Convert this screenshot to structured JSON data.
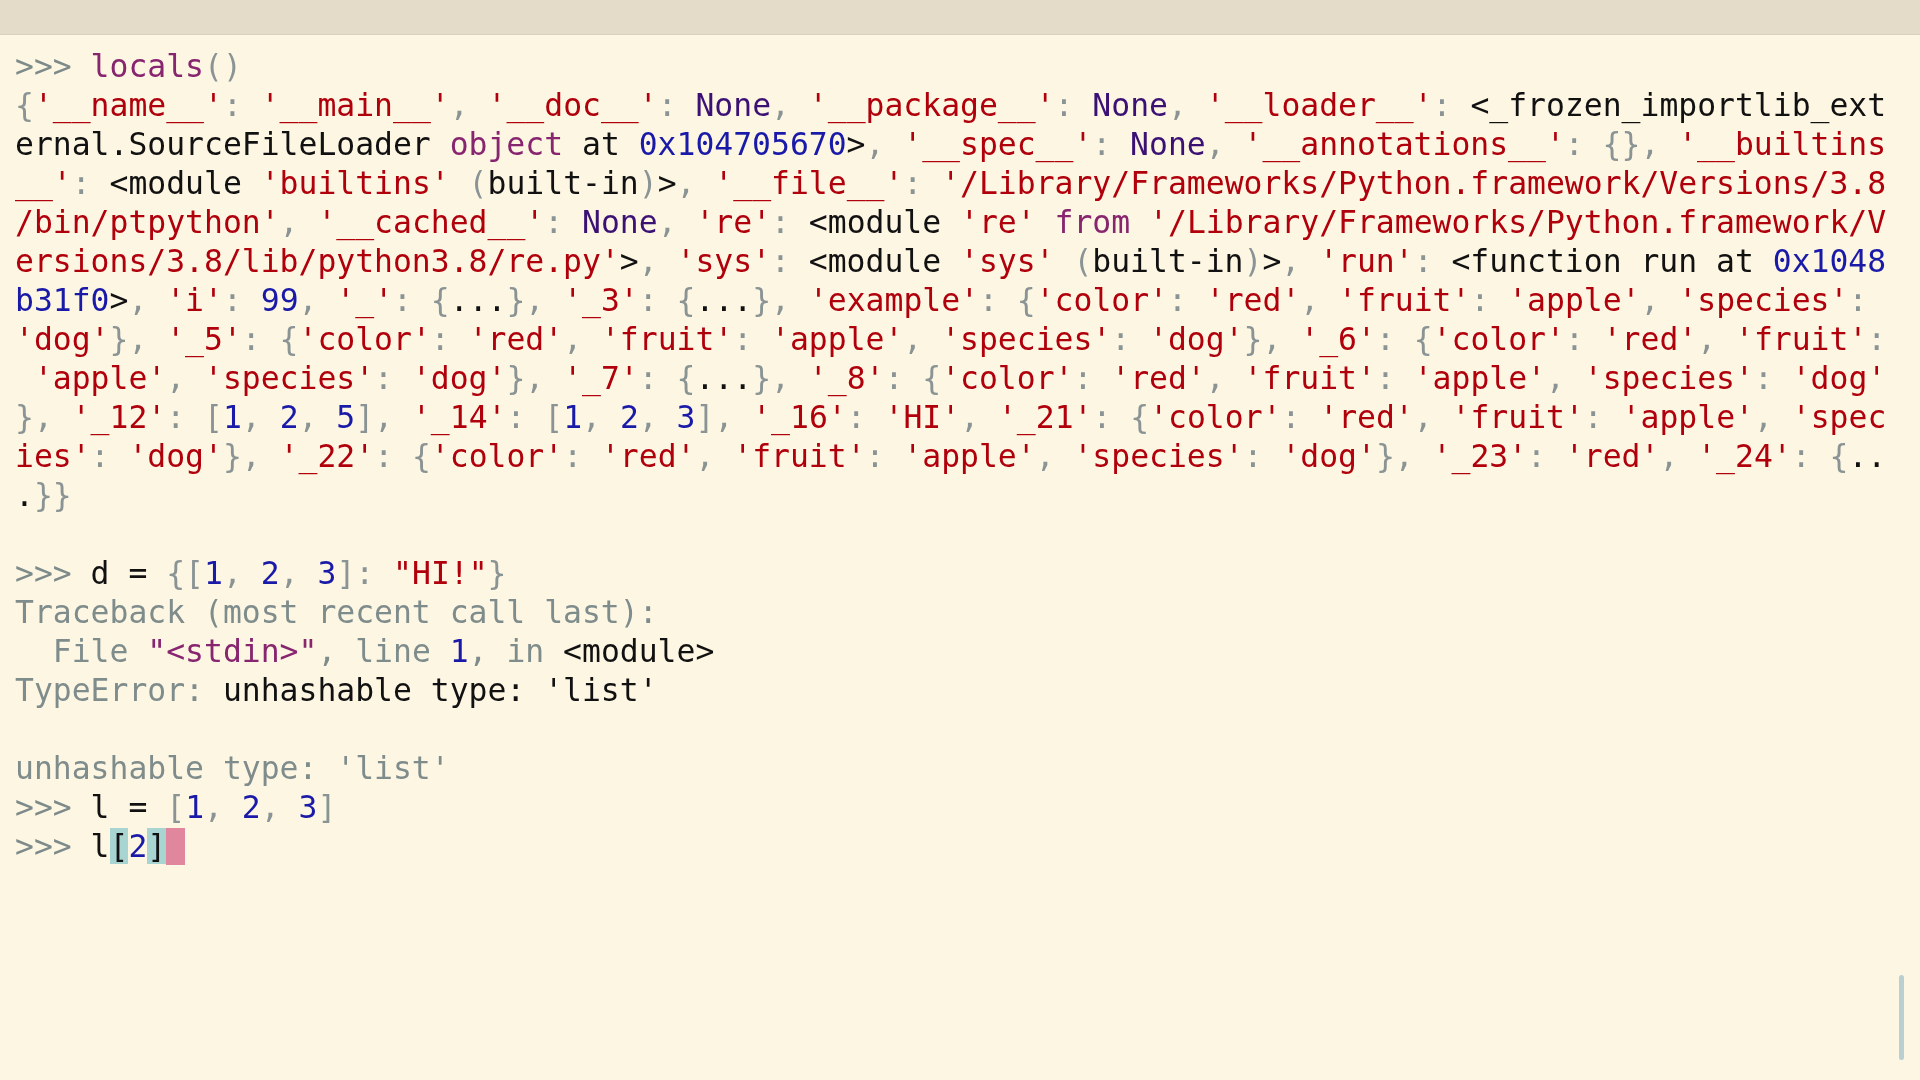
{
  "lines": [
    {
      "segments": [
        {
          "kind": "prompt",
          "text": ">>> "
        },
        {
          "kind": "keyword",
          "text": "locals"
        },
        {
          "kind": "punct",
          "text": "()"
        }
      ]
    },
    {
      "segments": [
        {
          "kind": "punct",
          "text": "{"
        },
        {
          "kind": "string",
          "text": "'__name__'"
        },
        {
          "kind": "punct",
          "text": ": "
        },
        {
          "kind": "string",
          "text": "'__main__'"
        },
        {
          "kind": "punct",
          "text": ", "
        },
        {
          "kind": "string",
          "text": "'__doc__'"
        },
        {
          "kind": "punct",
          "text": ": "
        },
        {
          "kind": "builtin",
          "text": "None"
        },
        {
          "kind": "punct",
          "text": ", "
        },
        {
          "kind": "string",
          "text": "'__package__'"
        },
        {
          "kind": "punct",
          "text": ": "
        },
        {
          "kind": "builtin",
          "text": "None"
        },
        {
          "kind": "punct",
          "text": ", "
        },
        {
          "kind": "string",
          "text": "'__loader__'"
        },
        {
          "kind": "punct",
          "text": ": "
        },
        {
          "kind": "plain",
          "text": "<_frozen_importlib_ext"
        }
      ]
    },
    {
      "segments": [
        {
          "kind": "plain",
          "text": "ernal.SourceFileLoader "
        },
        {
          "kind": "keyword",
          "text": "object"
        },
        {
          "kind": "plain",
          "text": " at "
        },
        {
          "kind": "number",
          "text": "0x104705670"
        },
        {
          "kind": "plain",
          "text": ">"
        },
        {
          "kind": "punct",
          "text": ", "
        },
        {
          "kind": "string",
          "text": "'__spec__'"
        },
        {
          "kind": "punct",
          "text": ": "
        },
        {
          "kind": "builtin",
          "text": "None"
        },
        {
          "kind": "punct",
          "text": ", "
        },
        {
          "kind": "string",
          "text": "'__annotations__'"
        },
        {
          "kind": "punct",
          "text": ": {}, "
        },
        {
          "kind": "string",
          "text": "'__builtins"
        }
      ]
    },
    {
      "segments": [
        {
          "kind": "string",
          "text": "__'"
        },
        {
          "kind": "punct",
          "text": ": "
        },
        {
          "kind": "plain",
          "text": "<module "
        },
        {
          "kind": "string",
          "text": "'builtins'"
        },
        {
          "kind": "punct",
          "text": " ("
        },
        {
          "kind": "plain",
          "text": "built-in"
        },
        {
          "kind": "punct",
          "text": ")"
        },
        {
          "kind": "plain",
          "text": ">"
        },
        {
          "kind": "punct",
          "text": ", "
        },
        {
          "kind": "string",
          "text": "'__file__'"
        },
        {
          "kind": "punct",
          "text": ": "
        },
        {
          "kind": "string",
          "text": "'/Library/Frameworks/Python.framework/Versions/3.8"
        }
      ]
    },
    {
      "segments": [
        {
          "kind": "string",
          "text": "/bin/ptpython'"
        },
        {
          "kind": "punct",
          "text": ", "
        },
        {
          "kind": "string",
          "text": "'__cached__'"
        },
        {
          "kind": "punct",
          "text": ": "
        },
        {
          "kind": "builtin",
          "text": "None"
        },
        {
          "kind": "punct",
          "text": ", "
        },
        {
          "kind": "string",
          "text": "'re'"
        },
        {
          "kind": "punct",
          "text": ": "
        },
        {
          "kind": "plain",
          "text": "<module "
        },
        {
          "kind": "string",
          "text": "'re'"
        },
        {
          "kind": "keyword",
          "text": " from "
        },
        {
          "kind": "string",
          "text": "'/Library/Frameworks/Python.framework/V"
        }
      ]
    },
    {
      "segments": [
        {
          "kind": "string",
          "text": "ersions/3.8/lib/python3.8/re.py'"
        },
        {
          "kind": "plain",
          "text": ">"
        },
        {
          "kind": "punct",
          "text": ", "
        },
        {
          "kind": "string",
          "text": "'sys'"
        },
        {
          "kind": "punct",
          "text": ": "
        },
        {
          "kind": "plain",
          "text": "<module "
        },
        {
          "kind": "string",
          "text": "'sys'"
        },
        {
          "kind": "punct",
          "text": " ("
        },
        {
          "kind": "plain",
          "text": "built-in"
        },
        {
          "kind": "punct",
          "text": ")"
        },
        {
          "kind": "plain",
          "text": ">"
        },
        {
          "kind": "punct",
          "text": ", "
        },
        {
          "kind": "string",
          "text": "'run'"
        },
        {
          "kind": "punct",
          "text": ": "
        },
        {
          "kind": "plain",
          "text": "<function run at "
        },
        {
          "kind": "number",
          "text": "0x1048"
        }
      ]
    },
    {
      "segments": [
        {
          "kind": "number",
          "text": "b31f0"
        },
        {
          "kind": "plain",
          "text": ">"
        },
        {
          "kind": "punct",
          "text": ", "
        },
        {
          "kind": "string",
          "text": "'i'"
        },
        {
          "kind": "punct",
          "text": ": "
        },
        {
          "kind": "number",
          "text": "99"
        },
        {
          "kind": "punct",
          "text": ", "
        },
        {
          "kind": "string",
          "text": "'_'"
        },
        {
          "kind": "punct",
          "text": ": {"
        },
        {
          "kind": "plain",
          "text": "..."
        },
        {
          "kind": "punct",
          "text": "}, "
        },
        {
          "kind": "string",
          "text": "'_3'"
        },
        {
          "kind": "punct",
          "text": ": {"
        },
        {
          "kind": "plain",
          "text": "..."
        },
        {
          "kind": "punct",
          "text": "}, "
        },
        {
          "kind": "string",
          "text": "'example'"
        },
        {
          "kind": "punct",
          "text": ": {"
        },
        {
          "kind": "string",
          "text": "'color'"
        },
        {
          "kind": "punct",
          "text": ": "
        },
        {
          "kind": "string",
          "text": "'red'"
        },
        {
          "kind": "punct",
          "text": ", "
        },
        {
          "kind": "string",
          "text": "'fruit'"
        },
        {
          "kind": "punct",
          "text": ": "
        },
        {
          "kind": "string",
          "text": "'apple'"
        },
        {
          "kind": "punct",
          "text": ", "
        },
        {
          "kind": "string",
          "text": "'species'"
        },
        {
          "kind": "punct",
          "text": ":"
        }
      ]
    },
    {
      "segments": [
        {
          "kind": "string",
          "text": "'dog'"
        },
        {
          "kind": "punct",
          "text": "}, "
        },
        {
          "kind": "string",
          "text": "'_5'"
        },
        {
          "kind": "punct",
          "text": ": {"
        },
        {
          "kind": "string",
          "text": "'color'"
        },
        {
          "kind": "punct",
          "text": ": "
        },
        {
          "kind": "string",
          "text": "'red'"
        },
        {
          "kind": "punct",
          "text": ", "
        },
        {
          "kind": "string",
          "text": "'fruit'"
        },
        {
          "kind": "punct",
          "text": ": "
        },
        {
          "kind": "string",
          "text": "'apple'"
        },
        {
          "kind": "punct",
          "text": ", "
        },
        {
          "kind": "string",
          "text": "'species'"
        },
        {
          "kind": "punct",
          "text": ": "
        },
        {
          "kind": "string",
          "text": "'dog'"
        },
        {
          "kind": "punct",
          "text": "}, "
        },
        {
          "kind": "string",
          "text": "'_6'"
        },
        {
          "kind": "punct",
          "text": ": {"
        },
        {
          "kind": "string",
          "text": "'color'"
        },
        {
          "kind": "punct",
          "text": ": "
        },
        {
          "kind": "string",
          "text": "'red'"
        },
        {
          "kind": "punct",
          "text": ", "
        },
        {
          "kind": "string",
          "text": "'fruit'"
        },
        {
          "kind": "punct",
          "text": ":"
        }
      ]
    },
    {
      "segments": [
        {
          "kind": "string",
          "text": " 'apple'"
        },
        {
          "kind": "punct",
          "text": ", "
        },
        {
          "kind": "string",
          "text": "'species'"
        },
        {
          "kind": "punct",
          "text": ": "
        },
        {
          "kind": "string",
          "text": "'dog'"
        },
        {
          "kind": "punct",
          "text": "}, "
        },
        {
          "kind": "string",
          "text": "'_7'"
        },
        {
          "kind": "punct",
          "text": ": {"
        },
        {
          "kind": "plain",
          "text": "..."
        },
        {
          "kind": "punct",
          "text": "}, "
        },
        {
          "kind": "string",
          "text": "'_8'"
        },
        {
          "kind": "punct",
          "text": ": {"
        },
        {
          "kind": "string",
          "text": "'color'"
        },
        {
          "kind": "punct",
          "text": ": "
        },
        {
          "kind": "string",
          "text": "'red'"
        },
        {
          "kind": "punct",
          "text": ", "
        },
        {
          "kind": "string",
          "text": "'fruit'"
        },
        {
          "kind": "punct",
          "text": ": "
        },
        {
          "kind": "string",
          "text": "'apple'"
        },
        {
          "kind": "punct",
          "text": ", "
        },
        {
          "kind": "string",
          "text": "'species'"
        },
        {
          "kind": "punct",
          "text": ": "
        },
        {
          "kind": "string",
          "text": "'dog'"
        }
      ]
    },
    {
      "segments": [
        {
          "kind": "punct",
          "text": "}, "
        },
        {
          "kind": "string",
          "text": "'_12'"
        },
        {
          "kind": "punct",
          "text": ": ["
        },
        {
          "kind": "number",
          "text": "1"
        },
        {
          "kind": "punct",
          "text": ", "
        },
        {
          "kind": "number",
          "text": "2"
        },
        {
          "kind": "punct",
          "text": ", "
        },
        {
          "kind": "number",
          "text": "5"
        },
        {
          "kind": "punct",
          "text": "], "
        },
        {
          "kind": "string",
          "text": "'_14'"
        },
        {
          "kind": "punct",
          "text": ": ["
        },
        {
          "kind": "number",
          "text": "1"
        },
        {
          "kind": "punct",
          "text": ", "
        },
        {
          "kind": "number",
          "text": "2"
        },
        {
          "kind": "punct",
          "text": ", "
        },
        {
          "kind": "number",
          "text": "3"
        },
        {
          "kind": "punct",
          "text": "], "
        },
        {
          "kind": "string",
          "text": "'_16'"
        },
        {
          "kind": "punct",
          "text": ": "
        },
        {
          "kind": "string",
          "text": "'HI'"
        },
        {
          "kind": "punct",
          "text": ", "
        },
        {
          "kind": "string",
          "text": "'_21'"
        },
        {
          "kind": "punct",
          "text": ": {"
        },
        {
          "kind": "string",
          "text": "'color'"
        },
        {
          "kind": "punct",
          "text": ": "
        },
        {
          "kind": "string",
          "text": "'red'"
        },
        {
          "kind": "punct",
          "text": ", "
        },
        {
          "kind": "string",
          "text": "'fruit'"
        },
        {
          "kind": "punct",
          "text": ": "
        },
        {
          "kind": "string",
          "text": "'apple'"
        },
        {
          "kind": "punct",
          "text": ", "
        },
        {
          "kind": "string",
          "text": "'spec"
        }
      ]
    },
    {
      "segments": [
        {
          "kind": "string",
          "text": "ies'"
        },
        {
          "kind": "punct",
          "text": ": "
        },
        {
          "kind": "string",
          "text": "'dog'"
        },
        {
          "kind": "punct",
          "text": "}, "
        },
        {
          "kind": "string",
          "text": "'_22'"
        },
        {
          "kind": "punct",
          "text": ": {"
        },
        {
          "kind": "string",
          "text": "'color'"
        },
        {
          "kind": "punct",
          "text": ": "
        },
        {
          "kind": "string",
          "text": "'red'"
        },
        {
          "kind": "punct",
          "text": ", "
        },
        {
          "kind": "string",
          "text": "'fruit'"
        },
        {
          "kind": "punct",
          "text": ": "
        },
        {
          "kind": "string",
          "text": "'apple'"
        },
        {
          "kind": "punct",
          "text": ", "
        },
        {
          "kind": "string",
          "text": "'species'"
        },
        {
          "kind": "punct",
          "text": ": "
        },
        {
          "kind": "string",
          "text": "'dog'"
        },
        {
          "kind": "punct",
          "text": "}, "
        },
        {
          "kind": "string",
          "text": "'_23'"
        },
        {
          "kind": "punct",
          "text": ": "
        },
        {
          "kind": "string",
          "text": "'red'"
        },
        {
          "kind": "punct",
          "text": ", "
        },
        {
          "kind": "string",
          "text": "'_24'"
        },
        {
          "kind": "punct",
          "text": ": {"
        },
        {
          "kind": "plain",
          "text": ".."
        }
      ]
    },
    {
      "segments": [
        {
          "kind": "plain",
          "text": "."
        },
        {
          "kind": "punct",
          "text": "}}"
        }
      ]
    },
    {
      "gap_before": true,
      "segments": [
        {
          "kind": "prompt",
          "text": ">>> "
        },
        {
          "kind": "plain",
          "text": "d = "
        },
        {
          "kind": "punct",
          "text": "{["
        },
        {
          "kind": "number",
          "text": "1"
        },
        {
          "kind": "punct",
          "text": ", "
        },
        {
          "kind": "number",
          "text": "2"
        },
        {
          "kind": "punct",
          "text": ", "
        },
        {
          "kind": "number",
          "text": "3"
        },
        {
          "kind": "punct",
          "text": "]: "
        },
        {
          "kind": "string",
          "text": "\"HI!\""
        },
        {
          "kind": "punct",
          "text": "}"
        }
      ]
    },
    {
      "segments": [
        {
          "kind": "muted",
          "text": "Traceback (most recent call last):"
        }
      ]
    },
    {
      "segments": [
        {
          "kind": "muted",
          "text": "  File "
        },
        {
          "kind": "keyword",
          "text": "\"<stdin>\""
        },
        {
          "kind": "muted",
          "text": ", line "
        },
        {
          "kind": "number",
          "text": "1"
        },
        {
          "kind": "muted",
          "text": ", in "
        },
        {
          "kind": "plain",
          "text": "<module>"
        }
      ]
    },
    {
      "segments": [
        {
          "kind": "muted",
          "text": "TypeError: "
        },
        {
          "kind": "plain",
          "text": "unhashable type: 'list'"
        }
      ]
    },
    {
      "gap_before": true,
      "segments": [
        {
          "kind": "muted",
          "text": "unhashable type: 'list'"
        }
      ]
    },
    {
      "segments": [
        {
          "kind": "prompt",
          "text": ">>> "
        },
        {
          "kind": "plain",
          "text": "l = "
        },
        {
          "kind": "punct",
          "text": "["
        },
        {
          "kind": "number",
          "text": "1"
        },
        {
          "kind": "punct",
          "text": ", "
        },
        {
          "kind": "number",
          "text": "2"
        },
        {
          "kind": "punct",
          "text": ", "
        },
        {
          "kind": "number",
          "text": "3"
        },
        {
          "kind": "punct",
          "text": "]"
        }
      ]
    },
    {
      "cursor": true,
      "segments": [
        {
          "kind": "prompt",
          "text": ">>> "
        },
        {
          "kind": "plain",
          "text": "l"
        },
        {
          "kind": "match",
          "text": "["
        },
        {
          "kind": "number",
          "text": "2"
        },
        {
          "kind": "match",
          "text": "]"
        }
      ]
    }
  ]
}
